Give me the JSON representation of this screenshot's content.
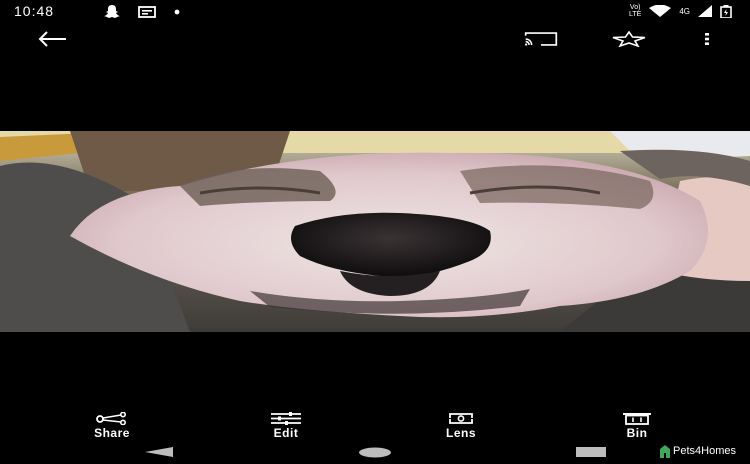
{
  "status_bar": {
    "time": "10:48",
    "network_small_1": "Vo)",
    "network_small_2": "LTE",
    "network_type": "4G",
    "left_icons": [
      "snapchat-icon",
      "image-notification-icon",
      "dot-icon"
    ],
    "right_icons": [
      "wifi-icon",
      "signal-icon",
      "signal-bars-icon",
      "battery-icon"
    ]
  },
  "top_bar": {
    "icons": [
      "back-arrow-icon",
      "cast-icon",
      "star-icon",
      "more-vert-icon"
    ]
  },
  "actions": {
    "share": "Share",
    "edit": "Edit",
    "lens": "Lens",
    "bin": "Bin"
  },
  "watermark": "Pets4Homes",
  "colors": {
    "background": "#000000",
    "foreground": "#ffffff"
  }
}
